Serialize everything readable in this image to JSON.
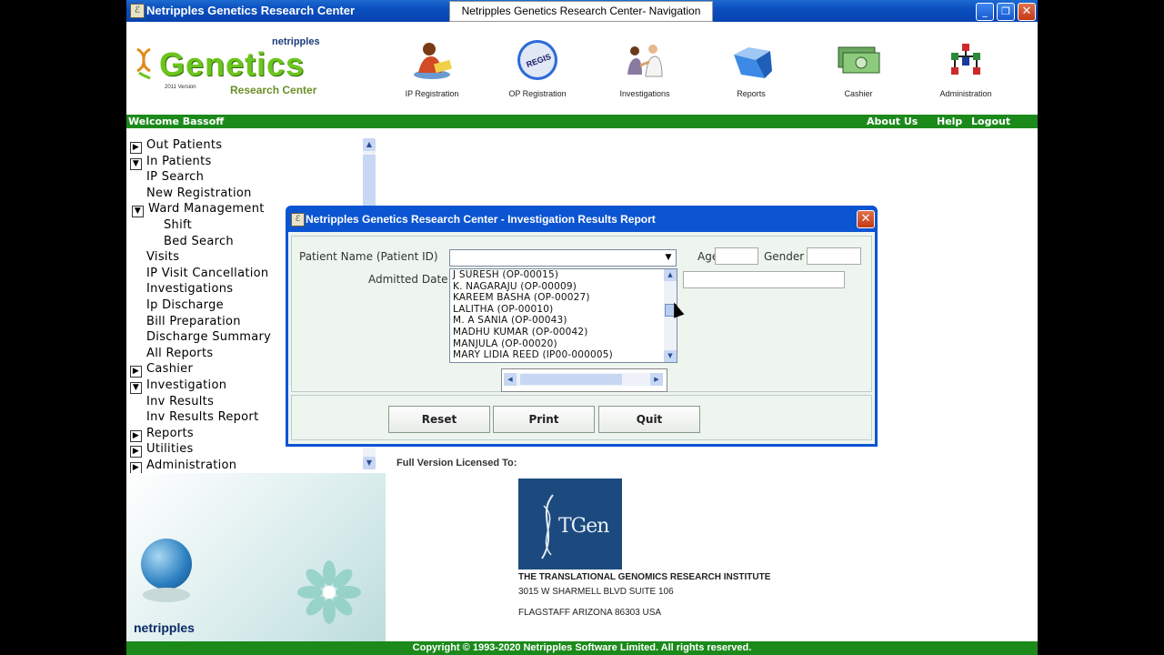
{
  "window": {
    "app_title": "Netripples Genetics Research Center",
    "nav_title": "Netripples  Genetics Research Center- Navigation",
    "minimize": "_",
    "maximize": "❐",
    "close": "✕"
  },
  "logo": {
    "brand_small": "netripples",
    "title": "Genetics",
    "version": "2011 Version",
    "subtitle": "Research Center"
  },
  "nav_icons": [
    {
      "label": "IP Registration",
      "icon": "ip-registration-icon"
    },
    {
      "label": "OP Registration",
      "icon": "op-registration-icon",
      "badge": "REGIS"
    },
    {
      "label": "Investigations",
      "icon": "investigations-icon"
    },
    {
      "label": "Reports",
      "icon": "reports-icon"
    },
    {
      "label": "Cashier",
      "icon": "cashier-icon"
    },
    {
      "label": "Administration",
      "icon": "administration-icon"
    }
  ],
  "greenbar": {
    "welcome": "Welcome Bassoff",
    "about": "About Us",
    "help": "Help",
    "logout": "Logout"
  },
  "tree": [
    {
      "label": "Out Patients",
      "level": 0,
      "toggle": "+"
    },
    {
      "label": "In Patients",
      "level": 0,
      "toggle": "-"
    },
    {
      "label": "IP Search",
      "level": 1
    },
    {
      "label": "New Registration",
      "level": 1
    },
    {
      "label": "Ward Management",
      "level": 1,
      "toggle": "-"
    },
    {
      "label": "Shift",
      "level": 2
    },
    {
      "label": "Bed Search",
      "level": 2
    },
    {
      "label": "Visits",
      "level": 1
    },
    {
      "label": "IP Visit Cancellation",
      "level": 1
    },
    {
      "label": "Investigations",
      "level": 1
    },
    {
      "label": "Ip Discharge",
      "level": 1
    },
    {
      "label": "Bill Preparation",
      "level": 1
    },
    {
      "label": "Discharge Summary",
      "level": 1
    },
    {
      "label": "All Reports",
      "level": 1
    },
    {
      "label": "Cashier",
      "level": 0,
      "toggle": "+"
    },
    {
      "label": "Investigation",
      "level": 0,
      "toggle": "-"
    },
    {
      "label": "Inv Results",
      "level": 1
    },
    {
      "label": "Inv Results Report",
      "level": 1
    },
    {
      "label": "Reports",
      "level": 0,
      "toggle": "+"
    },
    {
      "label": "Utilities",
      "level": 0,
      "toggle": "+"
    },
    {
      "label": "Administration",
      "level": 0,
      "toggle": "+"
    }
  ],
  "deco": {
    "brand": "netripples"
  },
  "license": {
    "heading": "Full Version Licensed To:",
    "logo_text": "TGen",
    "org_name": "THE TRANSLATIONAL GENOMICS RESEARCH INSTITUTE",
    "address1": "3015 W SHARMELL BLVD SUITE 106",
    "address2": "FLAGSTAFF ARIZONA 86303 USA"
  },
  "footer": "Copyright © 1993-2020 Netripples Software Limited. All rights reserved.",
  "dialog": {
    "title": "Netripples Genetics Research Center - Investigation Results Report",
    "patient_label": "Patient Name (Patient ID)",
    "patient_value": "",
    "age_label": "Age",
    "age_value": "",
    "gender_label": "Gender",
    "gender_value": "",
    "admitted_label": "Admitted Date",
    "options": [
      "J SURESH  (OP-00015)",
      "K. NAGARAJU  (OP-00009)",
      "KAREEM BASHA  (OP-00027)",
      "LALITHA  (OP-00010)",
      "M. A SANIA  (OP-00043)",
      "MADHU KUMAR  (OP-00042)",
      "MANJULA  (OP-00020)",
      "MARY LIDIA REED  (IP00-000005)"
    ],
    "buttons": {
      "reset": "Reset",
      "print": "Print",
      "quit": "Quit"
    }
  }
}
